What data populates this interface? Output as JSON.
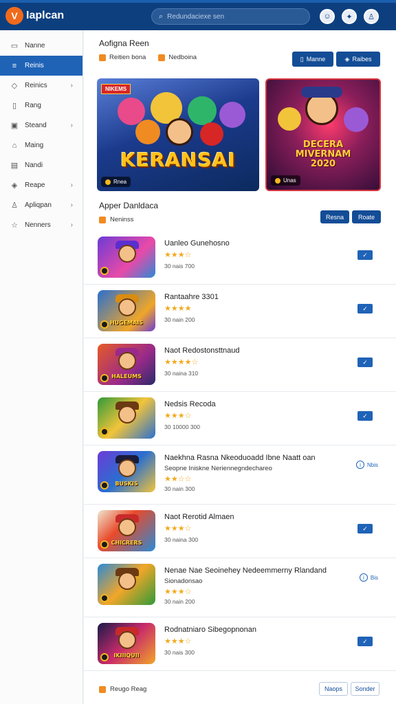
{
  "app": {
    "logo_mark": "V",
    "name": "Iaplcan"
  },
  "search": {
    "placeholder": "Redundaciexe sen"
  },
  "sidebar": {
    "items": [
      {
        "label": "Nanne",
        "icon": "monitor-icon",
        "glyph": "▭",
        "active": false,
        "chevron": false
      },
      {
        "label": "Reinis",
        "icon": "list-icon",
        "glyph": "≡",
        "active": true,
        "chevron": false
      },
      {
        "label": "Reinics",
        "icon": "diamond-icon",
        "glyph": "◇",
        "active": false,
        "chevron": true
      },
      {
        "label": "Rang",
        "icon": "book-icon",
        "glyph": "▯",
        "active": false,
        "chevron": false
      },
      {
        "label": "Steand",
        "icon": "image-icon",
        "glyph": "▣",
        "active": false,
        "chevron": true
      },
      {
        "label": "Maing",
        "icon": "folder-icon",
        "glyph": "⌂",
        "active": false,
        "chevron": false
      },
      {
        "label": "Nandi",
        "icon": "document-icon",
        "glyph": "▤",
        "active": false,
        "chevron": false
      },
      {
        "label": "Reape",
        "icon": "tag-icon",
        "glyph": "◈",
        "active": false,
        "chevron": true
      },
      {
        "label": "Apliqpan",
        "icon": "user-icon",
        "glyph": "♙",
        "active": false,
        "chevron": true
      },
      {
        "label": "Nenners",
        "icon": "star-icon",
        "glyph": "☆",
        "active": false,
        "chevron": true
      }
    ]
  },
  "header": {
    "title": "Aofigna Reen",
    "filter1": "Reitien bona",
    "filter2": "Nedboina",
    "button1": "Manne",
    "button2": "Raibes"
  },
  "banners": {
    "b1_tag": "NIKEMS",
    "b1_title": "KERANSAI",
    "b1_badge": "Rnea",
    "b2_title_1": "DECERA",
    "b2_title_2": "MIVERNAM",
    "b2_title_3": "2020",
    "b2_badge": "Unas"
  },
  "section": {
    "title": "Apper Danldaca",
    "chip": "Neninss",
    "button1": "Resna",
    "button2": "Roate"
  },
  "rows": [
    {
      "title": "Uanleo Gunehosno",
      "stars": "★★★☆",
      "meta": "30 nais 700",
      "label": "",
      "hat": "#5a2fd0",
      "bg": "linear-gradient(135deg,#6b3bd6,#e94aa8 60%,#2a8ad6)",
      "info": false
    },
    {
      "title": "Rantaahre 3301",
      "stars": "★★★★",
      "meta": "30 nain 200",
      "label": "HUGEMAIS",
      "hat": "#d98c12",
      "bg": "linear-gradient(135deg,#2a6fd0,#f0a628 70%,#6b3bd6)",
      "info": false
    },
    {
      "title": "Naot Redostonsttnaud",
      "stars": "★★★★☆",
      "meta": "30 naina 310",
      "label": "HALEUMS",
      "hat": "#9a2a8a",
      "bg": "linear-gradient(135deg,#e65a26,#9a2a8a 60%,#2a2a6a)",
      "info": false
    },
    {
      "title": "Nedsis Recoda",
      "stars": "★★★☆",
      "meta": "30 10000 300",
      "label": "",
      "hat": "#6b3a12",
      "bg": "linear-gradient(135deg,#2f9a3a,#f2c43a 50%,#2a6fd0)",
      "info": false
    },
    {
      "title": "Naekhna Rasna Nkeoduoadd Ibne Naatt oan",
      "subtitle": "Seopne Iniskne Neriennegndechareo",
      "stars": "★★☆☆",
      "meta": "30 nain 300",
      "label": "BUSKIS",
      "hat": "#1a1a3a",
      "bg": "linear-gradient(135deg,#6b3bd6,#2a6fd0 50%,#f2c43a)",
      "info": true,
      "info_text": "Nbis"
    },
    {
      "title": "Naot Rerotid Almaen",
      "stars": "★★★☆",
      "meta": "30 naina 300",
      "label": "CHICRERS",
      "hat": "#c82a2a",
      "bg": "linear-gradient(135deg,#f0e6d0,#e94a2a 40%,#2a8ad6)",
      "info": false
    },
    {
      "title": "Nenae Nae Seoinehey Nedeemmerny Rlandand",
      "subtitle": "Sionadonsao",
      "stars": "★★★☆",
      "meta": "30 nain 200",
      "label": "",
      "hat": "#6b3a12",
      "bg": "linear-gradient(135deg,#2a8ad6,#f2a628 50%,#2f9a3a)",
      "info": true,
      "info_text": "Bis"
    },
    {
      "title": "Rodnatniaro Sibegopnonan",
      "stars": "★★★☆",
      "meta": "30 nais 300",
      "label": "IKIIIQUII",
      "hat": "#c82a2a",
      "bg": "linear-gradient(135deg,#1a1a4a,#c82a6a 50%,#f2a628)",
      "info": false
    }
  ],
  "footer": {
    "chip": "Reugo Reag",
    "button1": "Naops",
    "button2": "Sonder"
  }
}
